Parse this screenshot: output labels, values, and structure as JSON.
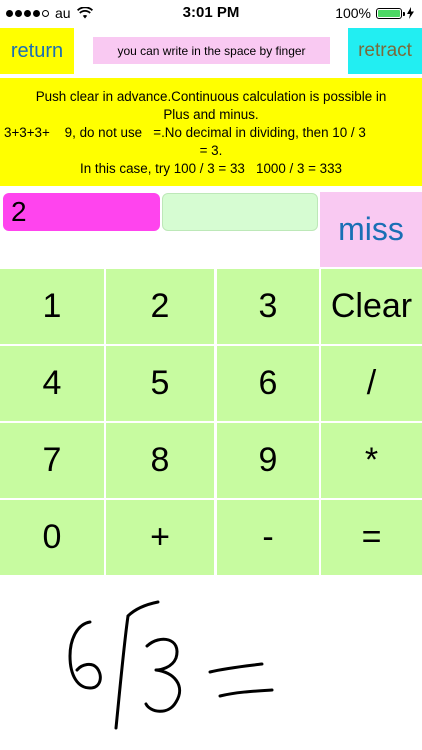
{
  "status_bar": {
    "carrier": "au",
    "time": "3:01 PM",
    "battery_percent": "100%",
    "signal_bars_filled": 4,
    "signal_bars_total": 5
  },
  "top_bar": {
    "return_label": "return",
    "hint_text": "you can write in the space by finger",
    "retract_label": "retract"
  },
  "instructions": {
    "line1": "Push clear in advance.Continuous calculation is possible in",
    "line2": "Plus and minus.",
    "line3": "3+3+3+    9, do not use   =.No decimal in dividing, then 10 / 3",
    "line4": "= 3.",
    "line5": "In this case, try 100 / 3 = 33   1000 / 3 = 333"
  },
  "display": {
    "entry_value": "2",
    "result_value": "",
    "miss_label": "miss"
  },
  "keypad": {
    "rows": [
      [
        "1",
        "2",
        "3",
        "Clear"
      ],
      [
        "4",
        "5",
        "6",
        "/"
      ],
      [
        "7",
        "8",
        "9",
        "*"
      ],
      [
        "0",
        "+",
        "-",
        "="
      ]
    ]
  },
  "colors": {
    "yellow": "#ffff00",
    "cyan": "#22eef2",
    "pink": "#f9c9f2",
    "magenta": "#ff44ee",
    "key_green": "#c7fba0",
    "link_blue": "#1a6fb5"
  }
}
